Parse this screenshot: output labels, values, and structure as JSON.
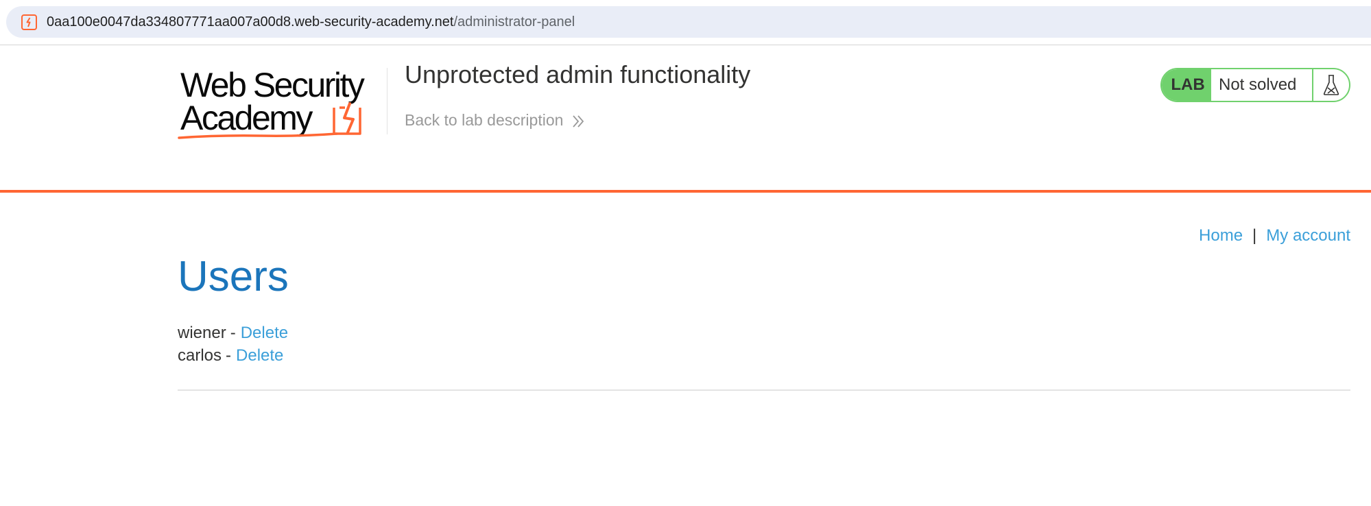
{
  "browser": {
    "url_host": "0aa100e0047da334807771aa007a00d8.web-security-academy.net",
    "url_path": "/administrator-panel",
    "site_icon": "lightning-bolt-icon"
  },
  "header": {
    "logo_text_line1": "Web Security",
    "logo_text_line2": "Academy",
    "lab_title": "Unprotected admin functionality",
    "back_link": "Back to lab description",
    "lab_badge": "LAB",
    "lab_status": "Not solved",
    "accent_color": "#ff6633",
    "status_color": "#70d16d"
  },
  "nav": {
    "home": "Home",
    "separator": "|",
    "my_account": "My account"
  },
  "main": {
    "heading": "Users",
    "users": [
      {
        "name": "wiener",
        "separator": "-",
        "action": "Delete"
      },
      {
        "name": "carlos",
        "separator": "-",
        "action": "Delete"
      }
    ]
  }
}
